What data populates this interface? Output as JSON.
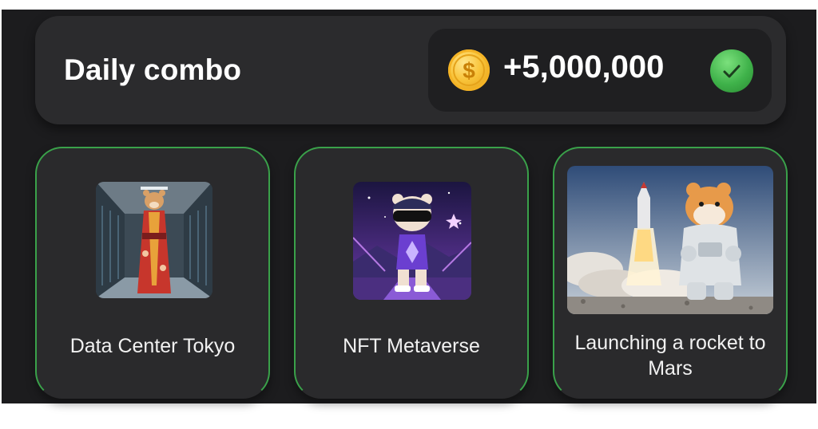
{
  "combo": {
    "title": "Daily combo",
    "reward_amount": "+5,000,000",
    "reward_icon": "gold-coin-icon",
    "status_icon": "checkmark-icon",
    "completed": true
  },
  "cards": [
    {
      "label": "Data Center Tokyo",
      "image": "hamster-kimono-data-center"
    },
    {
      "label": "NFT Metaverse",
      "image": "hamster-vr-headset-metaverse"
    },
    {
      "label": "Launching a rocket to Mars",
      "image": "hamster-astronaut-rocket-launch"
    }
  ],
  "colors": {
    "background": "#1c1c1e",
    "panel": "#2b2b2d",
    "card_border": "#3aa14a",
    "coin": "#f9c43a",
    "check": "#3fb24a"
  }
}
